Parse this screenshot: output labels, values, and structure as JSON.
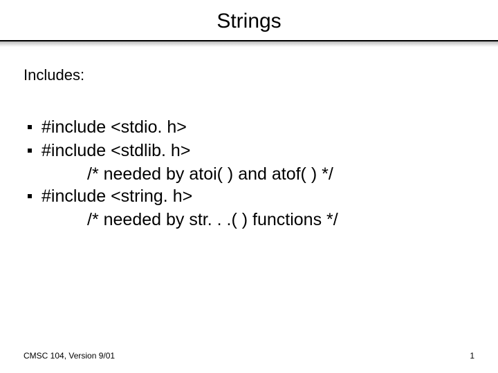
{
  "title": "Strings",
  "subheading": "Includes:",
  "bullets": [
    {
      "text": "#include <stdio. h>",
      "indent": null
    },
    {
      "text": "#include <stdlib. h>",
      "indent": "/* needed by atoi( ) and atof( ) */"
    },
    {
      "text": "#include <string. h>",
      "indent": "/* needed by str. . .( ) functions */"
    }
  ],
  "footer": {
    "left": "CMSC 104, Version 9/01",
    "right": "1"
  }
}
